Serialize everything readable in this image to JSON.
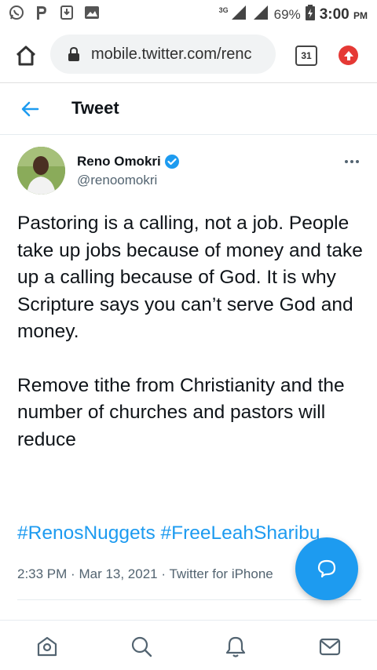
{
  "status_bar": {
    "network": "3G",
    "battery": "69%",
    "time": "3:00",
    "ampm": "PM",
    "icons": [
      "whatsapp-icon",
      "pinterest-icon",
      "download-icon",
      "image-icon"
    ]
  },
  "browser": {
    "url": "mobile.twitter.com/renc",
    "tab_count": "31"
  },
  "header": {
    "title": "Tweet"
  },
  "tweet": {
    "author_name": "Reno Omokri",
    "author_handle": "@renoomokri",
    "paragraphs": [
      "Pastoring is a calling, not a job. People take up jobs because of money and take up a calling because of God. It is why Scripture says you can’t serve God and money.",
      "Remove tithe from Christianity and the number of churches and pastors will reduce"
    ],
    "hashtags": "#RenosNuggets #FreeLeahSharibu",
    "time": "2:33 PM",
    "date": "Mar 13, 2021",
    "source": "Twitter for iPhone",
    "separator": "·"
  },
  "bottom_nav": [
    "home-icon",
    "search-icon",
    "notifications-icon",
    "messages-icon"
  ],
  "colors": {
    "accent": "#1d9bf0",
    "text": "#0f1419",
    "secondary": "#536471",
    "update_badge": "#e53935"
  }
}
